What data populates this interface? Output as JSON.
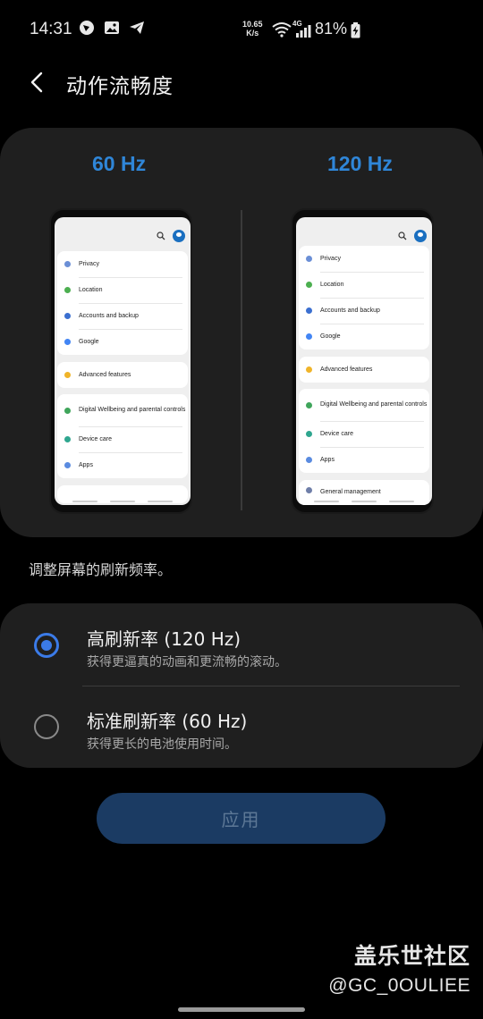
{
  "status_bar": {
    "time": "14:31",
    "net_speed_value": "10.65",
    "net_speed_unit": "K/s",
    "network_type": "4G",
    "battery_percent": "81%"
  },
  "header": {
    "title": "动作流畅度"
  },
  "preview": {
    "left_label": "60 Hz",
    "right_label": "120 Hz",
    "settings_items_left": [
      {
        "label": "Privacy",
        "icon": "shield-icon",
        "color": "#6b8fd6"
      },
      {
        "label": "Location",
        "icon": "location-pin-icon",
        "color": "#4caf50"
      },
      {
        "label": "Accounts and backup",
        "icon": "key-icon",
        "color": "#3b6fd0"
      },
      {
        "label": "Google",
        "icon": "google-icon",
        "color": "#4285f4"
      },
      {
        "label": "Advanced features",
        "icon": "gear-icon",
        "color": "#f0b429"
      },
      {
        "label": "Digital Wellbeing and parental controls",
        "icon": "wellbeing-icon",
        "color": "#3fa55b"
      },
      {
        "label": "Device care",
        "icon": "device-care-icon",
        "color": "#2fa68f"
      },
      {
        "label": "Apps",
        "icon": "apps-icon",
        "color": "#5a8be0"
      }
    ],
    "settings_items_right": [
      {
        "label": "Privacy",
        "icon": "shield-icon",
        "color": "#6b8fd6"
      },
      {
        "label": "Location",
        "icon": "location-pin-icon",
        "color": "#4caf50"
      },
      {
        "label": "Accounts and backup",
        "icon": "key-icon",
        "color": "#3b6fd0"
      },
      {
        "label": "Google",
        "icon": "google-icon",
        "color": "#4285f4"
      },
      {
        "label": "Advanced features",
        "icon": "gear-icon",
        "color": "#f0b429"
      },
      {
        "label": "Digital Wellbeing and parental controls",
        "icon": "wellbeing-icon",
        "color": "#3fa55b"
      },
      {
        "label": "Device care",
        "icon": "device-care-icon",
        "color": "#2fa68f"
      },
      {
        "label": "Apps",
        "icon": "apps-icon",
        "color": "#5a8be0"
      },
      {
        "label": "General management",
        "icon": "sliders-icon",
        "color": "#6f7ea8"
      }
    ]
  },
  "description": "调整屏幕的刷新频率。",
  "options": [
    {
      "title": "高刷新率 (120 Hz)",
      "subtitle": "获得更逼真的动画和更流畅的滚动。",
      "selected": true
    },
    {
      "title": "标准刷新率 (60 Hz)",
      "subtitle": "获得更长的电池使用时间。",
      "selected": false
    }
  ],
  "apply_label": "应用",
  "watermark": {
    "title": "盖乐世社区",
    "handle": "@GC_0OULIEE"
  },
  "colors": {
    "accent": "#3b7be8",
    "hz_label": "#2f86d8",
    "card_bg": "#1f1f1f",
    "apply_bg": "#1b3b63"
  }
}
